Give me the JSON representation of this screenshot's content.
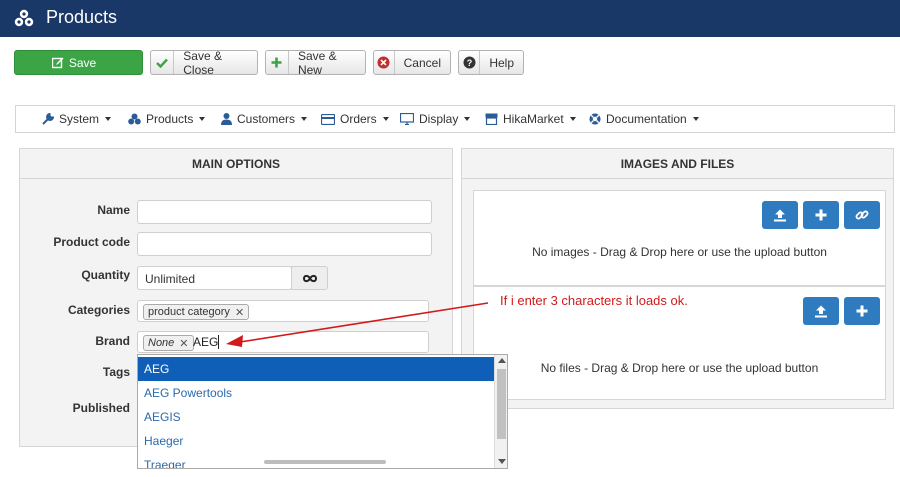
{
  "header": {
    "title": "Products"
  },
  "toolbar": {
    "save": "Save",
    "save_close": "Save & Close",
    "save_new": "Save & New",
    "cancel": "Cancel",
    "help": "Help"
  },
  "menu": {
    "system": "System",
    "products": "Products",
    "customers": "Customers",
    "orders": "Orders",
    "display": "Display",
    "hikamarket": "HikaMarket",
    "documentation": "Documentation"
  },
  "main_options": {
    "title": "MAIN OPTIONS",
    "name_label": "Name",
    "name_value": "",
    "code_label": "Product code",
    "code_value": "",
    "quantity_label": "Quantity",
    "quantity_value": "Unlimited",
    "categories_label": "Categories",
    "category_tag": "product category",
    "brand_label": "Brand",
    "brand_tag": "None",
    "brand_typed": "AEG",
    "tags_label": "Tags",
    "published_label": "Published"
  },
  "brand_dropdown": {
    "options": [
      "AEG",
      "AEG Powertools",
      "AEGIS",
      "Haeger",
      "Traeger"
    ],
    "selected_index": 0
  },
  "images_files": {
    "title": "IMAGES AND FILES",
    "images_text": "No images - Drag & Drop here or use the upload button",
    "files_text": "No files - Drag & Drop here or use the upload button"
  },
  "annotation": {
    "text": "If i enter 3 characters it loads ok."
  },
  "colors": {
    "header_bg": "#1a3867",
    "save_green": "#3ba545",
    "selected_blue": "#0f5fb8",
    "action_blue": "#2f7bbf",
    "annotation_red": "#d11b1b"
  }
}
